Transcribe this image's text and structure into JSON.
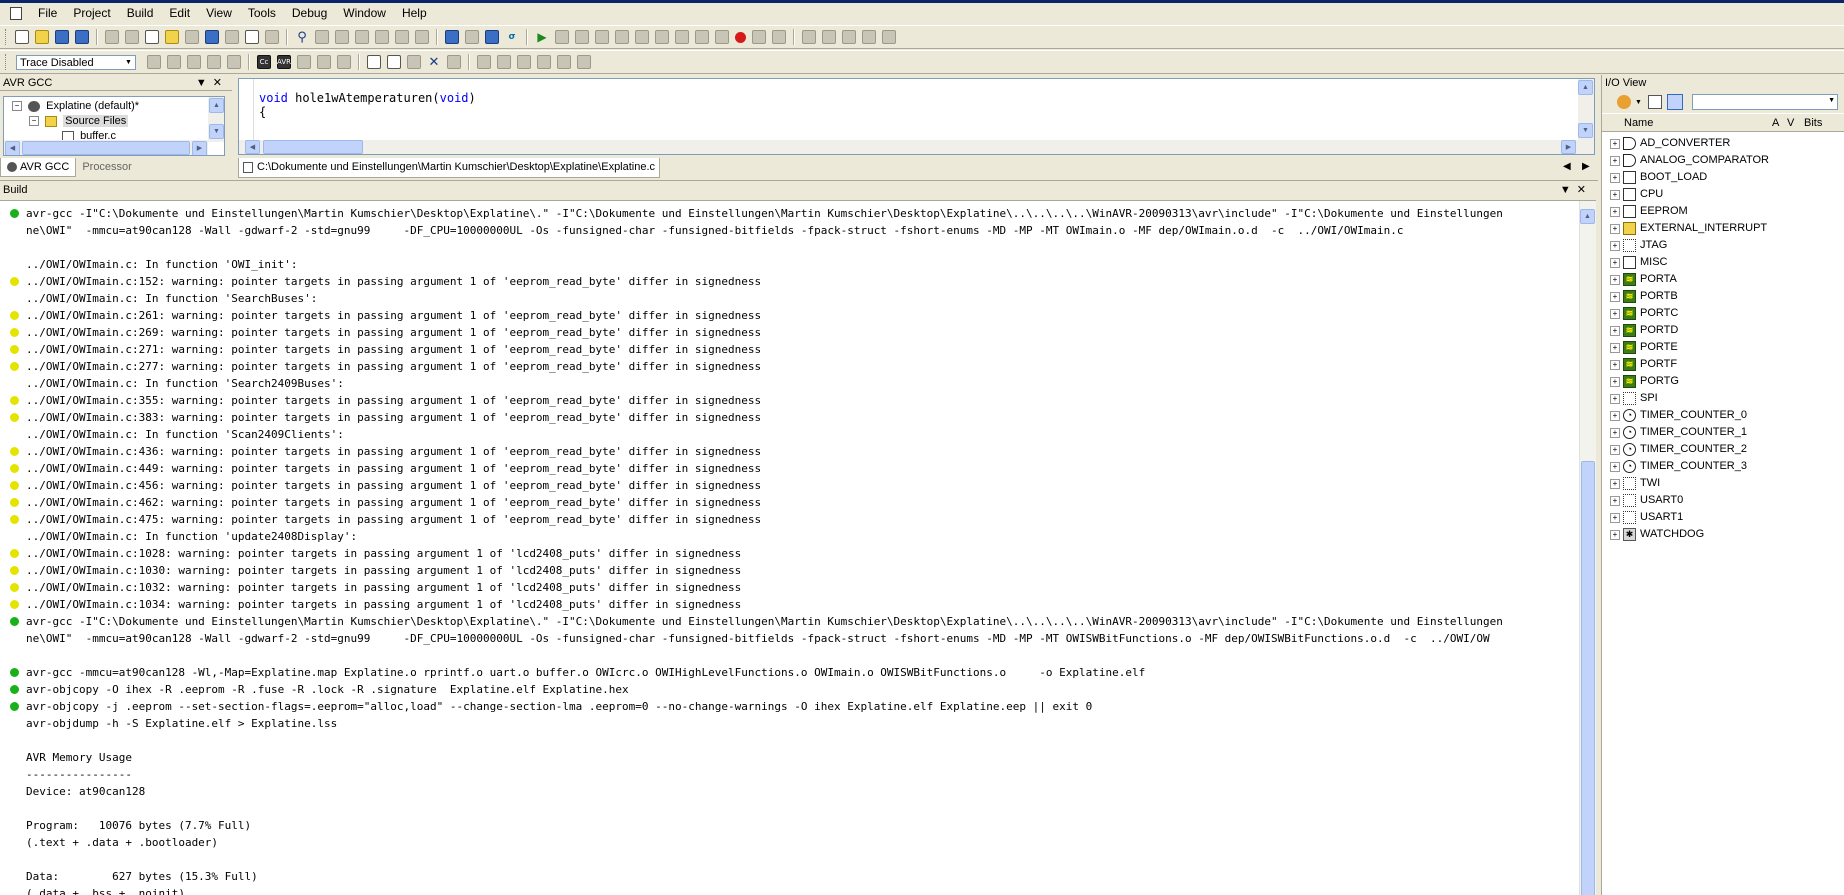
{
  "menu": [
    "File",
    "Project",
    "Build",
    "Edit",
    "View",
    "Tools",
    "Debug",
    "Window",
    "Help"
  ],
  "toolbar": {
    "trace_select": "Trace Disabled"
  },
  "left_panel": {
    "title": "AVR GCC",
    "tree": {
      "project": "Explatine (default)*",
      "folder": "Source Files",
      "file": "buffer.c"
    },
    "tabs": [
      "AVR GCC",
      "Processor"
    ]
  },
  "editor": {
    "line1_type": "void",
    "line1_name": " hole1wAtemperaturen(",
    "line1_arg": "void",
    "line1_end": ")",
    "line2": "{",
    "file_tab": "C:\\Dokumente und Einstellungen\\Martin Kumschier\\Desktop\\Explatine\\Explatine.c"
  },
  "io_view": {
    "title": "I/O View",
    "columns": [
      "Name",
      "A",
      "V",
      "Bits"
    ],
    "items": [
      {
        "name": "AD_CONVERTER",
        "icon": "ad-icon"
      },
      {
        "name": "ANALOG_COMPARATOR",
        "icon": "ad-icon"
      },
      {
        "name": "BOOT_LOAD",
        "icon": "register-icon"
      },
      {
        "name": "CPU",
        "icon": "register-icon"
      },
      {
        "name": "EEPROM",
        "icon": "register-icon"
      },
      {
        "name": "EXTERNAL_INTERRUPT",
        "icon": "interrupt-icon"
      },
      {
        "name": "JTAG",
        "icon": "spi-icon"
      },
      {
        "name": "MISC",
        "icon": "register-icon"
      },
      {
        "name": "PORTA",
        "icon": "port-icon"
      },
      {
        "name": "PORTB",
        "icon": "port-icon"
      },
      {
        "name": "PORTC",
        "icon": "port-icon"
      },
      {
        "name": "PORTD",
        "icon": "port-icon"
      },
      {
        "name": "PORTE",
        "icon": "port-icon"
      },
      {
        "name": "PORTF",
        "icon": "port-icon"
      },
      {
        "name": "PORTG",
        "icon": "port-icon"
      },
      {
        "name": "SPI",
        "icon": "spi-icon"
      },
      {
        "name": "TIMER_COUNTER_0",
        "icon": "timer-icon"
      },
      {
        "name": "TIMER_COUNTER_1",
        "icon": "timer-icon"
      },
      {
        "name": "TIMER_COUNTER_2",
        "icon": "timer-icon"
      },
      {
        "name": "TIMER_COUNTER_3",
        "icon": "timer-icon"
      },
      {
        "name": "TWI",
        "icon": "spi-icon"
      },
      {
        "name": "USART0",
        "icon": "spi-icon"
      },
      {
        "name": "USART1",
        "icon": "spi-icon"
      },
      {
        "name": "WATCHDOG",
        "icon": "watchdog-icon"
      }
    ]
  },
  "build": {
    "title": "Build",
    "lines": [
      {
        "dot": "green",
        "text": "avr-gcc -I\"C:\\Dokumente und Einstellungen\\Martin Kumschier\\Desktop\\Explatine\\.\" -I\"C:\\Dokumente und Einstellungen\\Martin Kumschier\\Desktop\\Explatine\\..\\..\\..\\..\\WinAVR-20090313\\avr\\include\" -I\"C:\\Dokumente und Einstellungen"
      },
      {
        "dot": "",
        "text": "ne\\OWI\"  -mmcu=at90can128 -Wall -gdwarf-2 -std=gnu99     -DF_CPU=10000000UL -Os -funsigned-char -funsigned-bitfields -fpack-struct -fshort-enums -MD -MP -MT OWImain.o -MF dep/OWImain.o.d  -c  ../OWI/OWImain.c"
      },
      {
        "dot": "",
        "text": ""
      },
      {
        "dot": "",
        "text": "../OWI/OWImain.c: In function 'OWI_init':"
      },
      {
        "dot": "yellow",
        "text": "../OWI/OWImain.c:152: warning: pointer targets in passing argument 1 of 'eeprom_read_byte' differ in signedness"
      },
      {
        "dot": "",
        "text": "../OWI/OWImain.c: In function 'SearchBuses':"
      },
      {
        "dot": "yellow",
        "text": "../OWI/OWImain.c:261: warning: pointer targets in passing argument 1 of 'eeprom_read_byte' differ in signedness"
      },
      {
        "dot": "yellow",
        "text": "../OWI/OWImain.c:269: warning: pointer targets in passing argument 1 of 'eeprom_read_byte' differ in signedness"
      },
      {
        "dot": "yellow",
        "text": "../OWI/OWImain.c:271: warning: pointer targets in passing argument 1 of 'eeprom_read_byte' differ in signedness"
      },
      {
        "dot": "yellow",
        "text": "../OWI/OWImain.c:277: warning: pointer targets in passing argument 1 of 'eeprom_read_byte' differ in signedness"
      },
      {
        "dot": "",
        "text": "../OWI/OWImain.c: In function 'Search2409Buses':"
      },
      {
        "dot": "yellow",
        "text": "../OWI/OWImain.c:355: warning: pointer targets in passing argument 1 of 'eeprom_read_byte' differ in signedness"
      },
      {
        "dot": "yellow",
        "text": "../OWI/OWImain.c:383: warning: pointer targets in passing argument 1 of 'eeprom_read_byte' differ in signedness"
      },
      {
        "dot": "",
        "text": "../OWI/OWImain.c: In function 'Scan2409Clients':"
      },
      {
        "dot": "yellow",
        "text": "../OWI/OWImain.c:436: warning: pointer targets in passing argument 1 of 'eeprom_read_byte' differ in signedness"
      },
      {
        "dot": "yellow",
        "text": "../OWI/OWImain.c:449: warning: pointer targets in passing argument 1 of 'eeprom_read_byte' differ in signedness"
      },
      {
        "dot": "yellow",
        "text": "../OWI/OWImain.c:456: warning: pointer targets in passing argument 1 of 'eeprom_read_byte' differ in signedness"
      },
      {
        "dot": "yellow",
        "text": "../OWI/OWImain.c:462: warning: pointer targets in passing argument 1 of 'eeprom_read_byte' differ in signedness"
      },
      {
        "dot": "yellow",
        "text": "../OWI/OWImain.c:475: warning: pointer targets in passing argument 1 of 'eeprom_read_byte' differ in signedness"
      },
      {
        "dot": "",
        "text": "../OWI/OWImain.c: In function 'update2408Display':"
      },
      {
        "dot": "yellow",
        "text": "../OWI/OWImain.c:1028: warning: pointer targets in passing argument 1 of 'lcd2408_puts' differ in signedness"
      },
      {
        "dot": "yellow",
        "text": "../OWI/OWImain.c:1030: warning: pointer targets in passing argument 1 of 'lcd2408_puts' differ in signedness"
      },
      {
        "dot": "yellow",
        "text": "../OWI/OWImain.c:1032: warning: pointer targets in passing argument 1 of 'lcd2408_puts' differ in signedness"
      },
      {
        "dot": "yellow",
        "text": "../OWI/OWImain.c:1034: warning: pointer targets in passing argument 1 of 'lcd2408_puts' differ in signedness"
      },
      {
        "dot": "green",
        "text": "avr-gcc -I\"C:\\Dokumente und Einstellungen\\Martin Kumschier\\Desktop\\Explatine\\.\" -I\"C:\\Dokumente und Einstellungen\\Martin Kumschier\\Desktop\\Explatine\\..\\..\\..\\..\\WinAVR-20090313\\avr\\include\" -I\"C:\\Dokumente und Einstellungen"
      },
      {
        "dot": "",
        "text": "ne\\OWI\"  -mmcu=at90can128 -Wall -gdwarf-2 -std=gnu99     -DF_CPU=10000000UL -Os -funsigned-char -funsigned-bitfields -fpack-struct -fshort-enums -MD -MP -MT OWISWBitFunctions.o -MF dep/OWISWBitFunctions.o.d  -c  ../OWI/OW"
      },
      {
        "dot": "",
        "text": ""
      },
      {
        "dot": "green",
        "text": "avr-gcc -mmcu=at90can128 -Wl,-Map=Explatine.map Explatine.o rprintf.o uart.o buffer.o OWIcrc.o OWIHighLevelFunctions.o OWImain.o OWISWBitFunctions.o     -o Explatine.elf"
      },
      {
        "dot": "green",
        "text": "avr-objcopy -O ihex -R .eeprom -R .fuse -R .lock -R .signature  Explatine.elf Explatine.hex"
      },
      {
        "dot": "green",
        "text": "avr-objcopy -j .eeprom --set-section-flags=.eeprom=\"alloc,load\" --change-section-lma .eeprom=0 --no-change-warnings -O ihex Explatine.elf Explatine.eep || exit 0"
      },
      {
        "dot": "",
        "text": "avr-objdump -h -S Explatine.elf > Explatine.lss"
      },
      {
        "dot": "",
        "text": ""
      },
      {
        "dot": "",
        "text": "AVR Memory Usage"
      },
      {
        "dot": "",
        "text": "----------------"
      },
      {
        "dot": "",
        "text": "Device: at90can128"
      },
      {
        "dot": "",
        "text": ""
      },
      {
        "dot": "",
        "text": "Program:   10076 bytes (7.7% Full)"
      },
      {
        "dot": "",
        "text": "(.text + .data + .bootloader)"
      },
      {
        "dot": "",
        "text": ""
      },
      {
        "dot": "",
        "text": "Data:        627 bytes (15.3% Full)"
      },
      {
        "dot": "",
        "text": "(.data + .bss + .noinit)"
      }
    ]
  }
}
